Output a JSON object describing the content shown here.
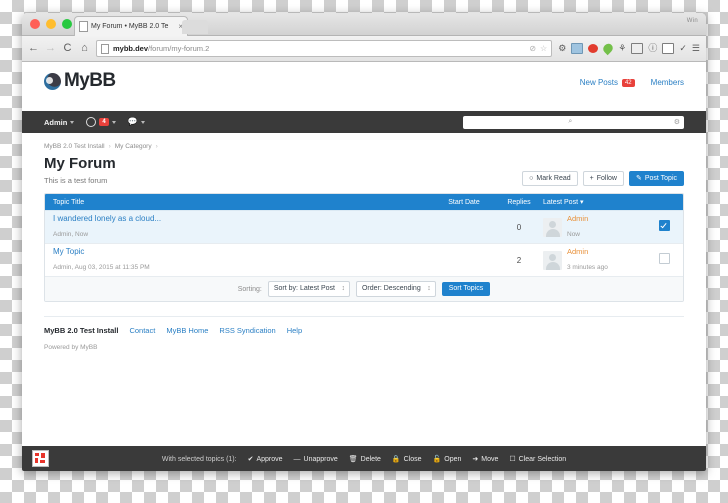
{
  "browser": {
    "tab_title": "My Forum • MyBB 2.0 Te",
    "tab_close": "×",
    "url_host": "mybb.dev",
    "url_path": "/forum/my-forum.2",
    "back_icon": "←",
    "forward_icon": "→",
    "reload_icon": "C",
    "home_icon": "⌂",
    "bookmark_icon": "☆",
    "share_icon": "⊘",
    "window_label": "Win",
    "extensions": [
      "gear-icon",
      "blue-card-icon",
      "red-circle-icon",
      "green-pin-icon",
      "eyedropper-icon",
      "frame-icon",
      "info-icon",
      "window-icon",
      "check-icon",
      "menu-icon"
    ]
  },
  "brand": {
    "name": "MyBB",
    "links": [
      {
        "label": "New Posts",
        "badge": "42"
      },
      {
        "label": "Members",
        "badge": ""
      }
    ]
  },
  "adminnav": {
    "user": "Admin",
    "alerts_badge": "4",
    "search_placeholder": "",
    "search_value": "",
    "search_icon": "⌕",
    "settings_icon": "⚙"
  },
  "breadcrumb": [
    {
      "label": "MyBB 2.0 Test Install"
    },
    {
      "label": "My Category"
    }
  ],
  "breadcrumb_separator": "›",
  "page": {
    "title": "My Forum",
    "description": "This is a test forum"
  },
  "actions": [
    {
      "label": "Mark Read",
      "icon": "○",
      "primary": false
    },
    {
      "label": "Follow",
      "icon": "+",
      "primary": false
    },
    {
      "label": "Post Topic",
      "icon": "✎",
      "primary": true
    }
  ],
  "table": {
    "headers": {
      "title": "Topic Title",
      "start_date": "Start Date",
      "replies": "Replies",
      "latest_post": "Latest Post",
      "sort_arrow": "▾"
    },
    "rows": [
      {
        "title": "I wandered lonely as a cloud...",
        "meta": "Admin, Now",
        "replies": "0",
        "latest_user": "Admin",
        "latest_time": "Now",
        "selected": true
      },
      {
        "title": "My Topic",
        "meta": "Admin, Aug 03, 2015 at 11:35 PM",
        "replies": "2",
        "latest_user": "Admin",
        "latest_time": "3 minutes ago",
        "selected": false
      }
    ]
  },
  "sorting": {
    "label": "Sorting:",
    "sort_by": "Sort by: Latest Post",
    "order": "Order: Descending",
    "button": "Sort Topics"
  },
  "footer": {
    "brand": "MyBB 2.0 Test Install",
    "links": [
      "Contact",
      "MyBB Home",
      "RSS Syndication",
      "Help"
    ],
    "powered": "Powered by MyBB"
  },
  "moderation": {
    "label": "With selected topics (1):",
    "items": [
      {
        "label": "Approve",
        "icon": "✔"
      },
      {
        "label": "Unapprove",
        "icon": "—"
      },
      {
        "label": "Delete",
        "icon": "🗑"
      },
      {
        "label": "Close",
        "icon": "🔒"
      },
      {
        "label": "Open",
        "icon": "🔓"
      },
      {
        "label": "Move",
        "icon": "➜"
      },
      {
        "label": "Clear Selection",
        "icon": "☐"
      }
    ]
  },
  "colors": {
    "accent": "#1f82cd",
    "link": "#2a7fc4",
    "badge": "#e8413b",
    "username": "#e8913a",
    "dark": "#3a3a3a"
  }
}
